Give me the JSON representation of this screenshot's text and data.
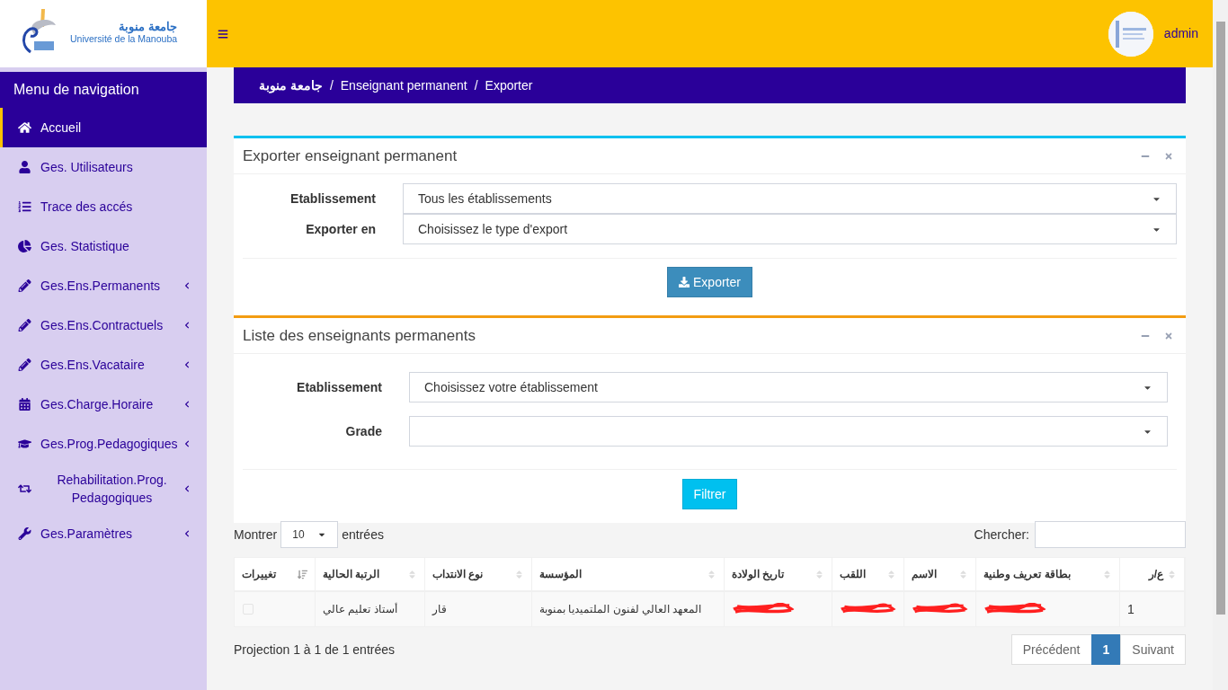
{
  "logo": {
    "arabic": "جامعة منوبة",
    "latin": "Université de la Manouba"
  },
  "header": {
    "user": "admin"
  },
  "sidebar": {
    "title": "Menu de navigation",
    "items": [
      {
        "label": "Accueil",
        "selected": true,
        "expandable": false
      },
      {
        "label": "Ges. Utilisateurs",
        "selected": false,
        "expandable": false
      },
      {
        "label": "Trace des accés",
        "selected": false,
        "expandable": false
      },
      {
        "label": "Ges. Statistique",
        "selected": false,
        "expandable": false
      },
      {
        "label": "Ges.Ens.Permanents",
        "selected": false,
        "expandable": true
      },
      {
        "label": "Ges.Ens.Contractuels",
        "selected": false,
        "expandable": true
      },
      {
        "label": "Ges.Ens.Vacataire",
        "selected": false,
        "expandable": true
      },
      {
        "label": "Ges.Charge.Horaire",
        "selected": false,
        "expandable": true
      },
      {
        "label": "Ges.Prog.Pedagogiques",
        "selected": false,
        "expandable": true
      },
      {
        "label": "Rehabilitation.Prog. Pedagogiques",
        "selected": false,
        "expandable": true
      },
      {
        "label": "Ges.Paramètres",
        "selected": false,
        "expandable": true
      }
    ]
  },
  "breadcrumb": {
    "separator": "/",
    "items": [
      "جامعة منوبة",
      "Enseignant permanent",
      "Exporter"
    ]
  },
  "export_panel": {
    "title": "Exporter enseignant permanent",
    "fields": [
      {
        "label": "Etablissement",
        "value": "Tous les établissements"
      },
      {
        "label": "Exporter en",
        "value": "Choisissez le type d'export"
      }
    ],
    "button": "Exporter"
  },
  "list_panel": {
    "title": "Liste des enseignants permanents",
    "fields": [
      {
        "label": "Etablissement",
        "value": "Choisissez votre établissement"
      },
      {
        "label": "Grade"
      }
    ],
    "button": "Filtrer",
    "length": {
      "before": "Montrer",
      "value": "10",
      "after": "entrées"
    },
    "search_label": "Chercher:",
    "table": {
      "columns": [
        "تغييرات",
        "الرتبة الحالية",
        "نوع الانتداب",
        "المؤسسة",
        "تاريخ الولادة",
        "اللقب",
        "الاسم",
        "بطاقة تعريف وطنية",
        "ع/ر"
      ],
      "rows": [
        {
          "cells": [
            {
              "kind": "checkbox",
              "checked": false
            },
            {
              "kind": "text",
              "text": "أستاذ تعليم عالي"
            },
            {
              "kind": "text",
              "text": "قار"
            },
            {
              "kind": "text",
              "text": "المعهد العالي لفنون الملتميديا بمنوبة"
            },
            {
              "kind": "redacted"
            },
            {
              "kind": "redacted"
            },
            {
              "kind": "redacted"
            },
            {
              "kind": "redacted"
            },
            {
              "kind": "text",
              "text": "1"
            }
          ]
        }
      ]
    },
    "info": "Projection 1 à 1 de 1 entrées",
    "pagination": [
      {
        "label": "Précédent",
        "selected": false
      },
      {
        "label": "1",
        "selected": true
      },
      {
        "label": "Suivant",
        "selected": false
      }
    ]
  }
}
